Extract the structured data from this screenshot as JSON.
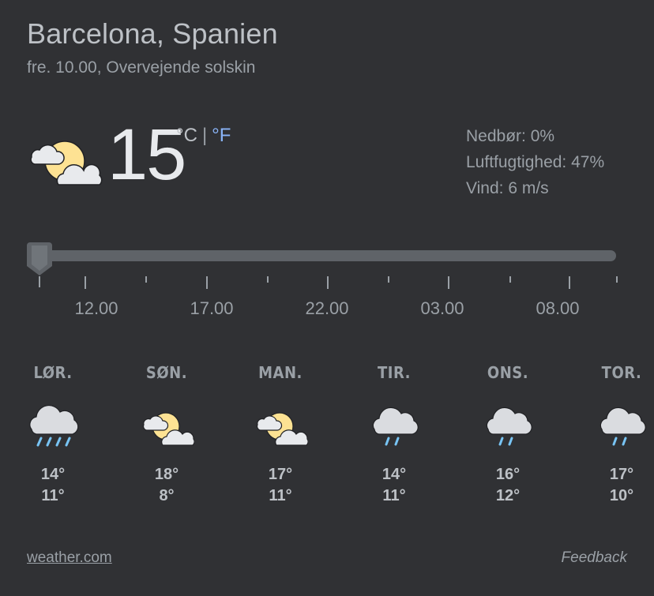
{
  "location": "Barcelona, Spanien",
  "subtitle": "fre. 10.00, Overvejende solskin",
  "current": {
    "icon": "partly-sunny-icon",
    "temperature": "15",
    "unit_c": "°C",
    "unit_sep": "|",
    "unit_f": "°F",
    "precipitation": "Nedbør: 0%",
    "humidity": "Luftfugtighed: 47%",
    "wind": "Vind: 6 m/s"
  },
  "timeline": {
    "labels": [
      "12.00",
      "17.00",
      "22.00",
      "03.00",
      "08.00"
    ],
    "position": 0
  },
  "forecast": [
    {
      "day": "LØR.",
      "icon": "rain-icon",
      "high": "14°",
      "low": "11°"
    },
    {
      "day": "SØN.",
      "icon": "partly-sunny-icon",
      "high": "18°",
      "low": "8°"
    },
    {
      "day": "MAN.",
      "icon": "partly-sunny-icon",
      "high": "17°",
      "low": "11°"
    },
    {
      "day": "TIR.",
      "icon": "showers-icon",
      "high": "14°",
      "low": "11°"
    },
    {
      "day": "ONS.",
      "icon": "showers-icon",
      "high": "16°",
      "low": "12°"
    },
    {
      "day": "TOR.",
      "icon": "showers-icon",
      "high": "17°",
      "low": "10°"
    }
  ],
  "footer": {
    "source": "weather.com",
    "feedback": "Feedback"
  },
  "colors": {
    "background": "#303134",
    "accent_link": "#8ab4f8",
    "sun": "#fde293",
    "cloud": "#dadce0",
    "rain": "#78c4f4"
  }
}
